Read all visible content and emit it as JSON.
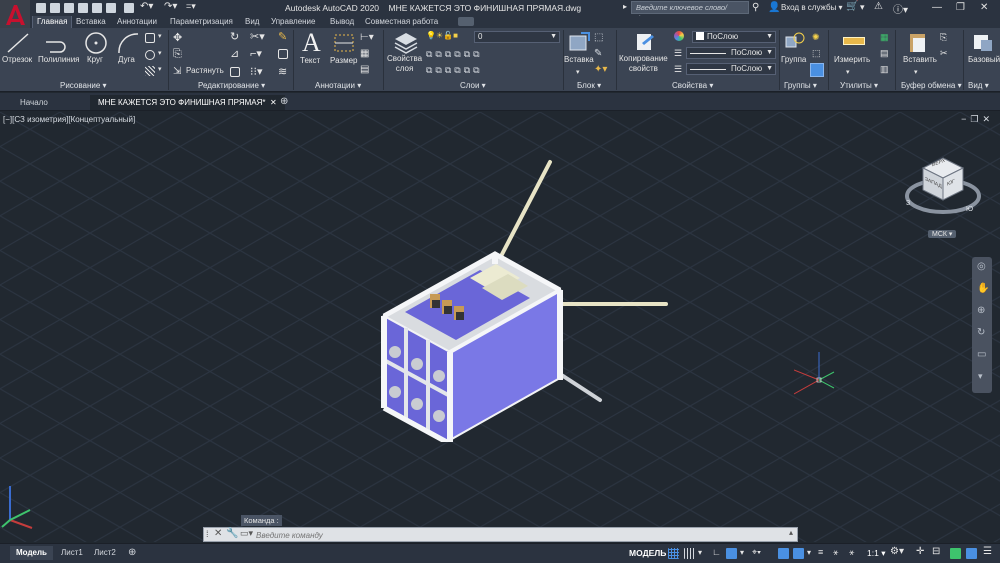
{
  "titlebar": {
    "app_title": "Autodesk AutoCAD 2020",
    "file_title": "МНЕ КАЖЕТСЯ ЭТО ФИНИШНАЯ ПРЯМАЯ.dwg",
    "search_placeholder": "Введите ключевое слово/фразу",
    "login_label": "Вход в службы",
    "logo_letter": "A"
  },
  "ribbon_tabs": [
    {
      "label": "Главная",
      "active": true
    },
    {
      "label": "Вставка"
    },
    {
      "label": "Аннотации"
    },
    {
      "label": "Параметризация"
    },
    {
      "label": "Вид"
    },
    {
      "label": "Управление"
    },
    {
      "label": "Вывод"
    },
    {
      "label": "Совместная работа"
    }
  ],
  "ribbon": {
    "draw": {
      "title": "Рисование",
      "line": "Отрезок",
      "polyline": "Полилиния",
      "circle": "Круг",
      "arc": "Дуга"
    },
    "modify": {
      "title": "Редактирование",
      "stretch": "Растянуть"
    },
    "annotation": {
      "title": "Аннотации",
      "text": "Текст",
      "dimension": "Размер"
    },
    "layers": {
      "title": "Слои",
      "properties_line1": "Свойства",
      "properties_line2": "слоя",
      "current_layer": "0"
    },
    "block": {
      "title": "Блок",
      "insert": "Вставка"
    },
    "properties": {
      "title": "Свойства",
      "match_line1": "Копирование",
      "match_line2": "свойств",
      "color": "ПоСлою",
      "linetype": "ПоСлою",
      "lineweight": "ПоСлою"
    },
    "groups": {
      "title": "Группы",
      "group": "Группа"
    },
    "utilities": {
      "title": "Утилиты",
      "measure": "Измерить"
    },
    "clipboard": {
      "title": "Буфер обмена",
      "paste": "Вставить"
    },
    "view": {
      "title": "Вид",
      "base": "Базовый"
    }
  },
  "file_tabs": [
    {
      "label": "Начало"
    },
    {
      "label": "МНЕ КАЖЕТСЯ ЭТО ФИНИШНАЯ ПРЯМАЯ*",
      "active": true
    }
  ],
  "viewport": {
    "view_label": "[−][СЗ изометрия][Концептуальный]",
    "viewcube": {
      "top": "ВЕРХ",
      "left": "ЗАПАД",
      "front": "ЮГ",
      "ucs_label": "МСК"
    },
    "compass": {
      "s": "Ю",
      "w": "З"
    }
  },
  "command": {
    "label": "Команда :",
    "placeholder": "Введите команду"
  },
  "layout_tabs": [
    {
      "label": "Модель",
      "active": true
    },
    {
      "label": "Лист1"
    },
    {
      "label": "Лист2"
    }
  ],
  "status": {
    "model": "МОДЕЛЬ",
    "scale": "1:1"
  },
  "colors": {
    "background": "#212830",
    "ribbon": "#3b4453",
    "panel_face": "#6a66d8",
    "frame": "#e3e6ea",
    "accent": "#4a90e2",
    "logo_red": "#c8102e"
  }
}
